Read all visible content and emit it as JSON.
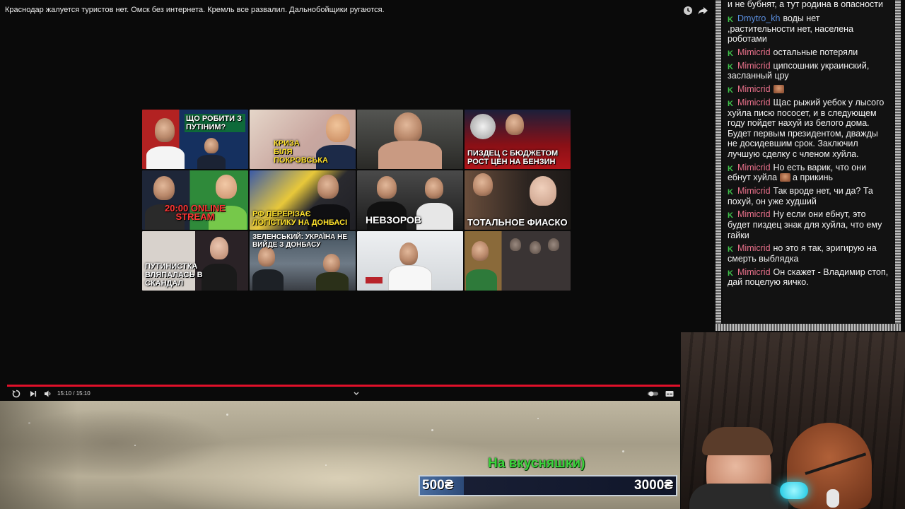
{
  "player": {
    "title": "Краснодар жалуется туристов нет. Омск без интернета. Кремль все развалил. Дальнобойщики ругаются.",
    "time": "15:10 / 15:10",
    "icons": [
      "clock-icon",
      "share-icon",
      "replay-icon",
      "next-icon",
      "volume-icon",
      "chevron-down-icon",
      "autoplay-toggle-icon",
      "subtitles-icon"
    ],
    "accent_color": "#e0102a",
    "progress": 1.0
  },
  "end_screen": {
    "thumbnails": [
      {
        "caption": "ЩО РОБИТИ З ПУТІНИМ?",
        "bg": "#1f3a6a"
      },
      {
        "caption": "КРИЗА БІЛЯ ПОКРОВСЬКА",
        "bg": "#c9b6a8"
      },
      {
        "caption": "",
        "bg": "#2d2e2a"
      },
      {
        "caption": "ПИЗДЕЦ С БЮДЖЕТОМ РОСТ ЦЕН НА БЕНЗИН",
        "bg": "#7a1014"
      },
      {
        "caption": "20:00 ONLINE STREAM",
        "bg": "#222a3a"
      },
      {
        "caption": "РФ ПЕРЕРІЗАЄ ЛОГІСТИКУ НА ДОНБАСІ",
        "bg": "#3a3a40"
      },
      {
        "caption": "НЕВЗОРОВ",
        "bg": "#2a2a2a"
      },
      {
        "caption": "ТОТАЛЬНОЕ ФИАСКО",
        "bg": "#3a2a20"
      },
      {
        "caption": "ПУТИНИСТКА ВЛЯПАЛАСЬ В СКАНДАЛ",
        "bg": "#2a2226"
      },
      {
        "caption": "ЗЕЛЕНСЬКИЙ: УКРАЇНА НЕ ВИЙДЕ З ДОНБАСУ",
        "bg": "#33424e"
      },
      {
        "caption": "",
        "bg": "#dfe2e4"
      },
      {
        "caption": "",
        "bg": "#4a3a30"
      }
    ]
  },
  "donation": {
    "label": "На вкусняшки)",
    "min": "500₴",
    "max": "3000₴",
    "progress": 0.17
  },
  "chat": {
    "partial_top": "и не бубнят, а тут родина в опасности",
    "messages": [
      {
        "user": "Dmytro_kh",
        "color": "#5b8fe0",
        "text": "воды нет ,растительности нет, населена роботами"
      },
      {
        "user": "Mimicrid",
        "color": "#e8708a",
        "text": "остальные потеряли"
      },
      {
        "user": "Mimicrid",
        "color": "#e8708a",
        "text": "ципсошник украинский, засланный цру"
      },
      {
        "user": "Mimicrid",
        "color": "#e8708a",
        "text": "",
        "emote": true
      },
      {
        "user": "Mimicrid",
        "color": "#e8708a",
        "text": "Щас рыжий уебок у лысого хуйла писю пососет, и в следующем году пойдет нахуй из белого дома. Будет первым президентом, дважды не досидевшим срок. Заключил лучшую сделку с членом хуйла."
      },
      {
        "user": "Mimicrid",
        "color": "#e8708a",
        "text": "Но есть варик, что они ебнут хуйла",
        "emote_inline": true,
        "after": "а прикинь"
      },
      {
        "user": "Mimicrid",
        "color": "#e8708a",
        "text": "Так вроде нет, чи да? Та похуй, он уже худший"
      },
      {
        "user": "Mimicrid",
        "color": "#e8708a",
        "text": "Ну если они ебнут, это будет пиздец знак для хуйла, что ему гайки"
      },
      {
        "user": "Mimicrid",
        "color": "#e8708a",
        "text": "но это я так, эригирую на смерть выблядка"
      },
      {
        "user": "Mimicrid",
        "color": "#e8708a",
        "text": "Он скажет - Владимир стоп, дай поцелую яичко."
      }
    ],
    "badge_icon": "kick-badge-icon",
    "badge_color": "#3fc14a"
  }
}
